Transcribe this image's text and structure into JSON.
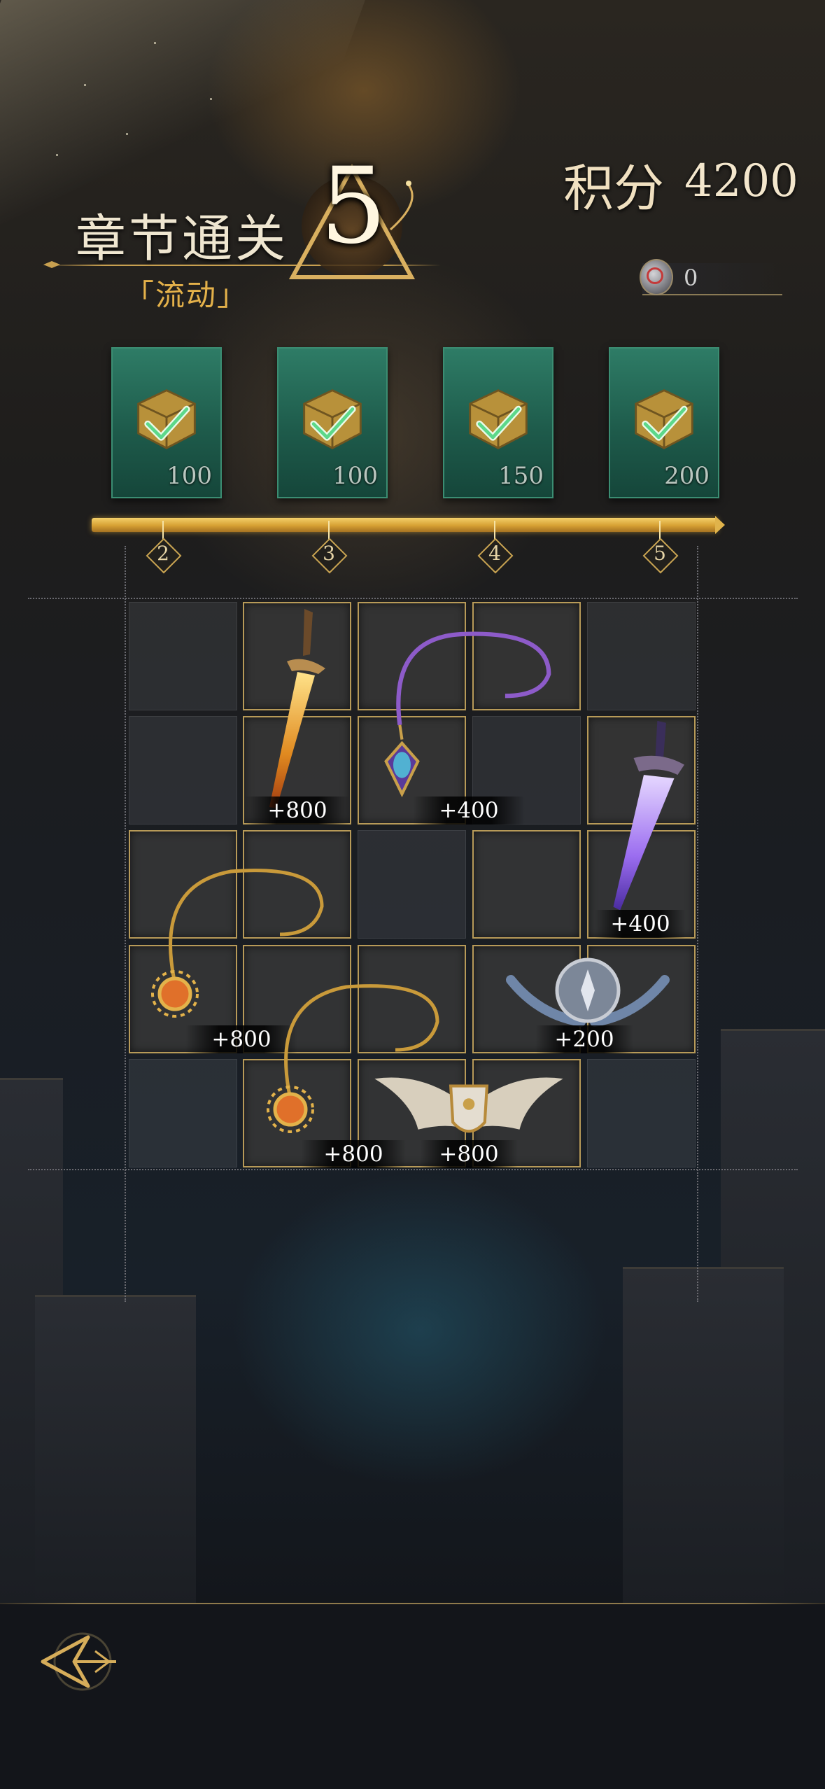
{
  "header": {
    "chapter_title": "章节通关",
    "chapter_subtitle": "「流动」",
    "chapter_number": "5",
    "score_label": "积分",
    "score_value": "4200",
    "currency_value": "0",
    "currency_icon": "gem-coin-icon"
  },
  "rewards": [
    {
      "amount": "100",
      "claimed": true,
      "icon": "gold-cube-chest-icon"
    },
    {
      "amount": "100",
      "claimed": true,
      "icon": "gold-cube-chest-icon"
    },
    {
      "amount": "150",
      "claimed": true,
      "icon": "gold-cube-chest-icon"
    },
    {
      "amount": "200",
      "claimed": true,
      "icon": "gold-cube-chest-icon"
    }
  ],
  "progress": {
    "fill": 1.0,
    "markers": [
      "2",
      "3",
      "4",
      "5"
    ]
  },
  "board": {
    "items": [
      {
        "name": "golden-dagger",
        "label": "+800"
      },
      {
        "name": "purple-pendant-necklace",
        "label": "+400"
      },
      {
        "name": "violet-crystal-sword",
        "label": "+400"
      },
      {
        "name": "sun-pendant-necklace",
        "label": "+800"
      },
      {
        "name": "laurel-shield-emblem",
        "label": "+200"
      },
      {
        "name": "sun-pendant-necklace-2",
        "label": "+800"
      },
      {
        "name": "winged-shield",
        "label": "+800"
      }
    ]
  },
  "colors": {
    "gold": "#d6a033",
    "card_green": "#1e5b4b",
    "cell_border": "#b79a58"
  }
}
